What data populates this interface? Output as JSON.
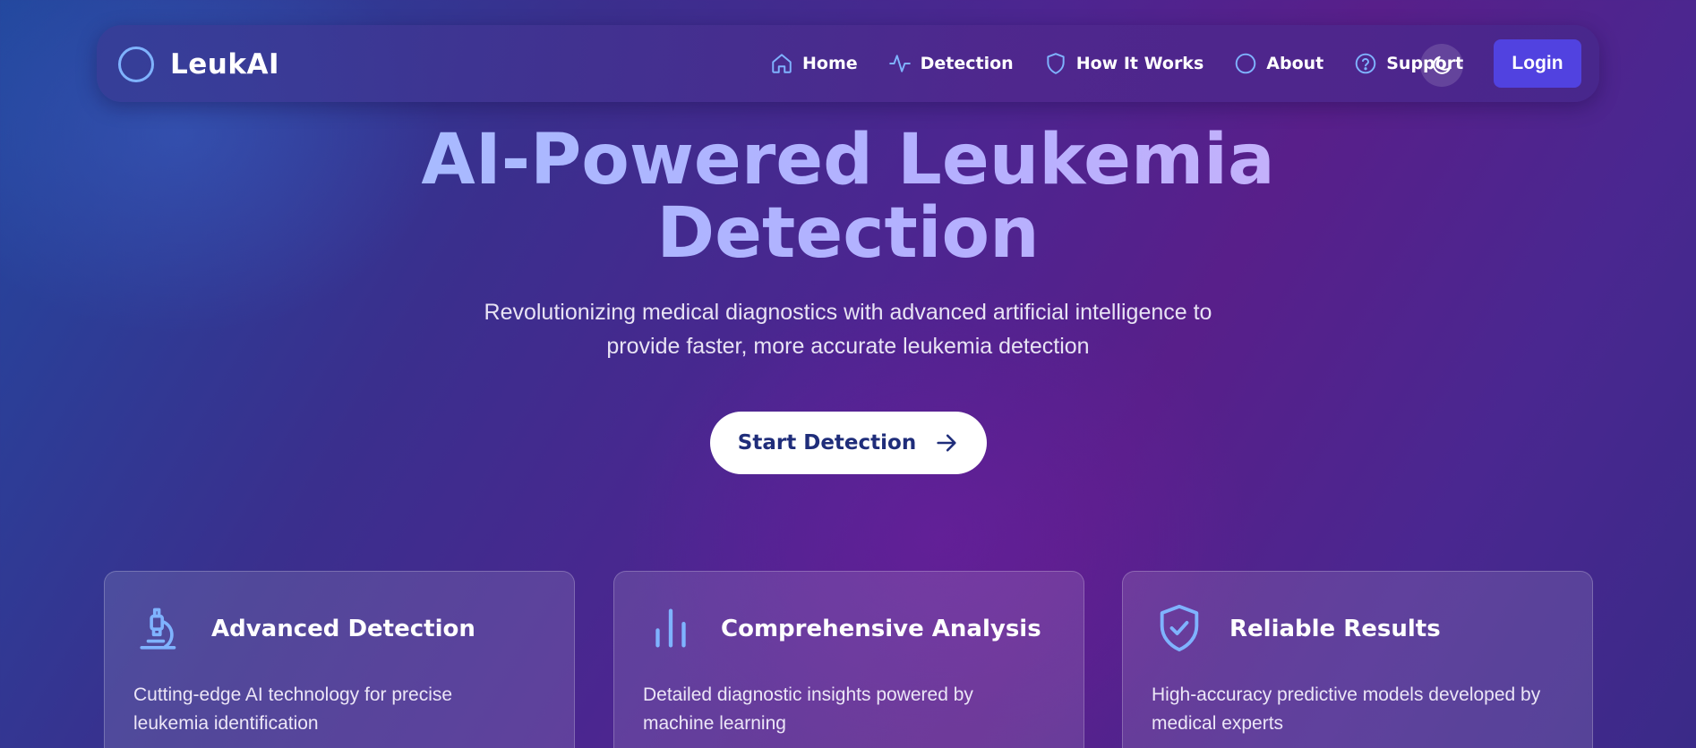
{
  "brand": {
    "name": "LeukAI"
  },
  "nav": {
    "items": [
      {
        "label": "Home",
        "icon": "home-icon"
      },
      {
        "label": "Detection",
        "icon": "activity-icon"
      },
      {
        "label": "How It Works",
        "icon": "shield-icon"
      },
      {
        "label": "About",
        "icon": "circle-icon"
      },
      {
        "label": "Support",
        "icon": "help-circle-icon"
      }
    ],
    "theme_toggle_icon": "moon-icon",
    "login_label": "Login"
  },
  "hero": {
    "title_line1": "AI-Powered Leukemia",
    "title_line2": "Detection",
    "subtitle_line1": "Revolutionizing medical diagnostics with advanced artificial intelligence to",
    "subtitle_line2": "provide faster, more accurate leukemia detection",
    "cta_label": "Start Detection",
    "cta_icon": "arrow-right-icon"
  },
  "features": [
    {
      "title": "Advanced Detection",
      "desc_line1": "Cutting-edge AI technology for precise",
      "desc_line2": "leukemia identification",
      "icon": "microscope-icon"
    },
    {
      "title": "Comprehensive Analysis",
      "desc_line1": "Detailed diagnostic insights powered by",
      "desc_line2": "machine learning",
      "icon": "bar-chart-icon"
    },
    {
      "title": "Reliable Results",
      "desc_line1": "High-accuracy predictive models developed by",
      "desc_line2": "medical experts",
      "icon": "shield-check-icon"
    }
  ],
  "colors": {
    "accent_icon": "#7fb3ff",
    "login_bg": "#5142e0",
    "cta_text": "#1f2d7a"
  }
}
